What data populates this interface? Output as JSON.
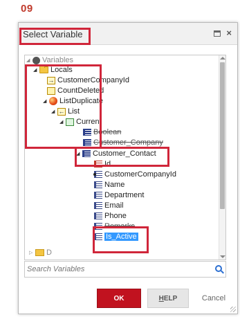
{
  "step_number": "09",
  "dialog": {
    "title": "Select Variable",
    "search_placeholder": "Search Variables",
    "buttons": {
      "ok": "OK",
      "help_first": "H",
      "help_rest": "ELP",
      "cancel": "Cancel"
    }
  },
  "tree": {
    "root": "Variables",
    "locals": "Locals",
    "customer_company_id": "CustomerCompanyId",
    "count_deleted": "CountDeleted",
    "list_duplicate": "ListDuplicate",
    "list": "List",
    "current": "Current",
    "boolean": "Boolean",
    "customer_company": "Customer_Company",
    "customer_contact": "Customer_Contact",
    "attributes": [
      "Id",
      "CustomerCompanyId",
      "Name",
      "Department",
      "Email",
      "Phone",
      "Remarks"
    ],
    "selected_attribute": "Is_Active",
    "partial_bottom": "D"
  },
  "colors": {
    "accent": "#c1121f",
    "highlight_box": "#d0263a",
    "selection": "#3399ff"
  }
}
